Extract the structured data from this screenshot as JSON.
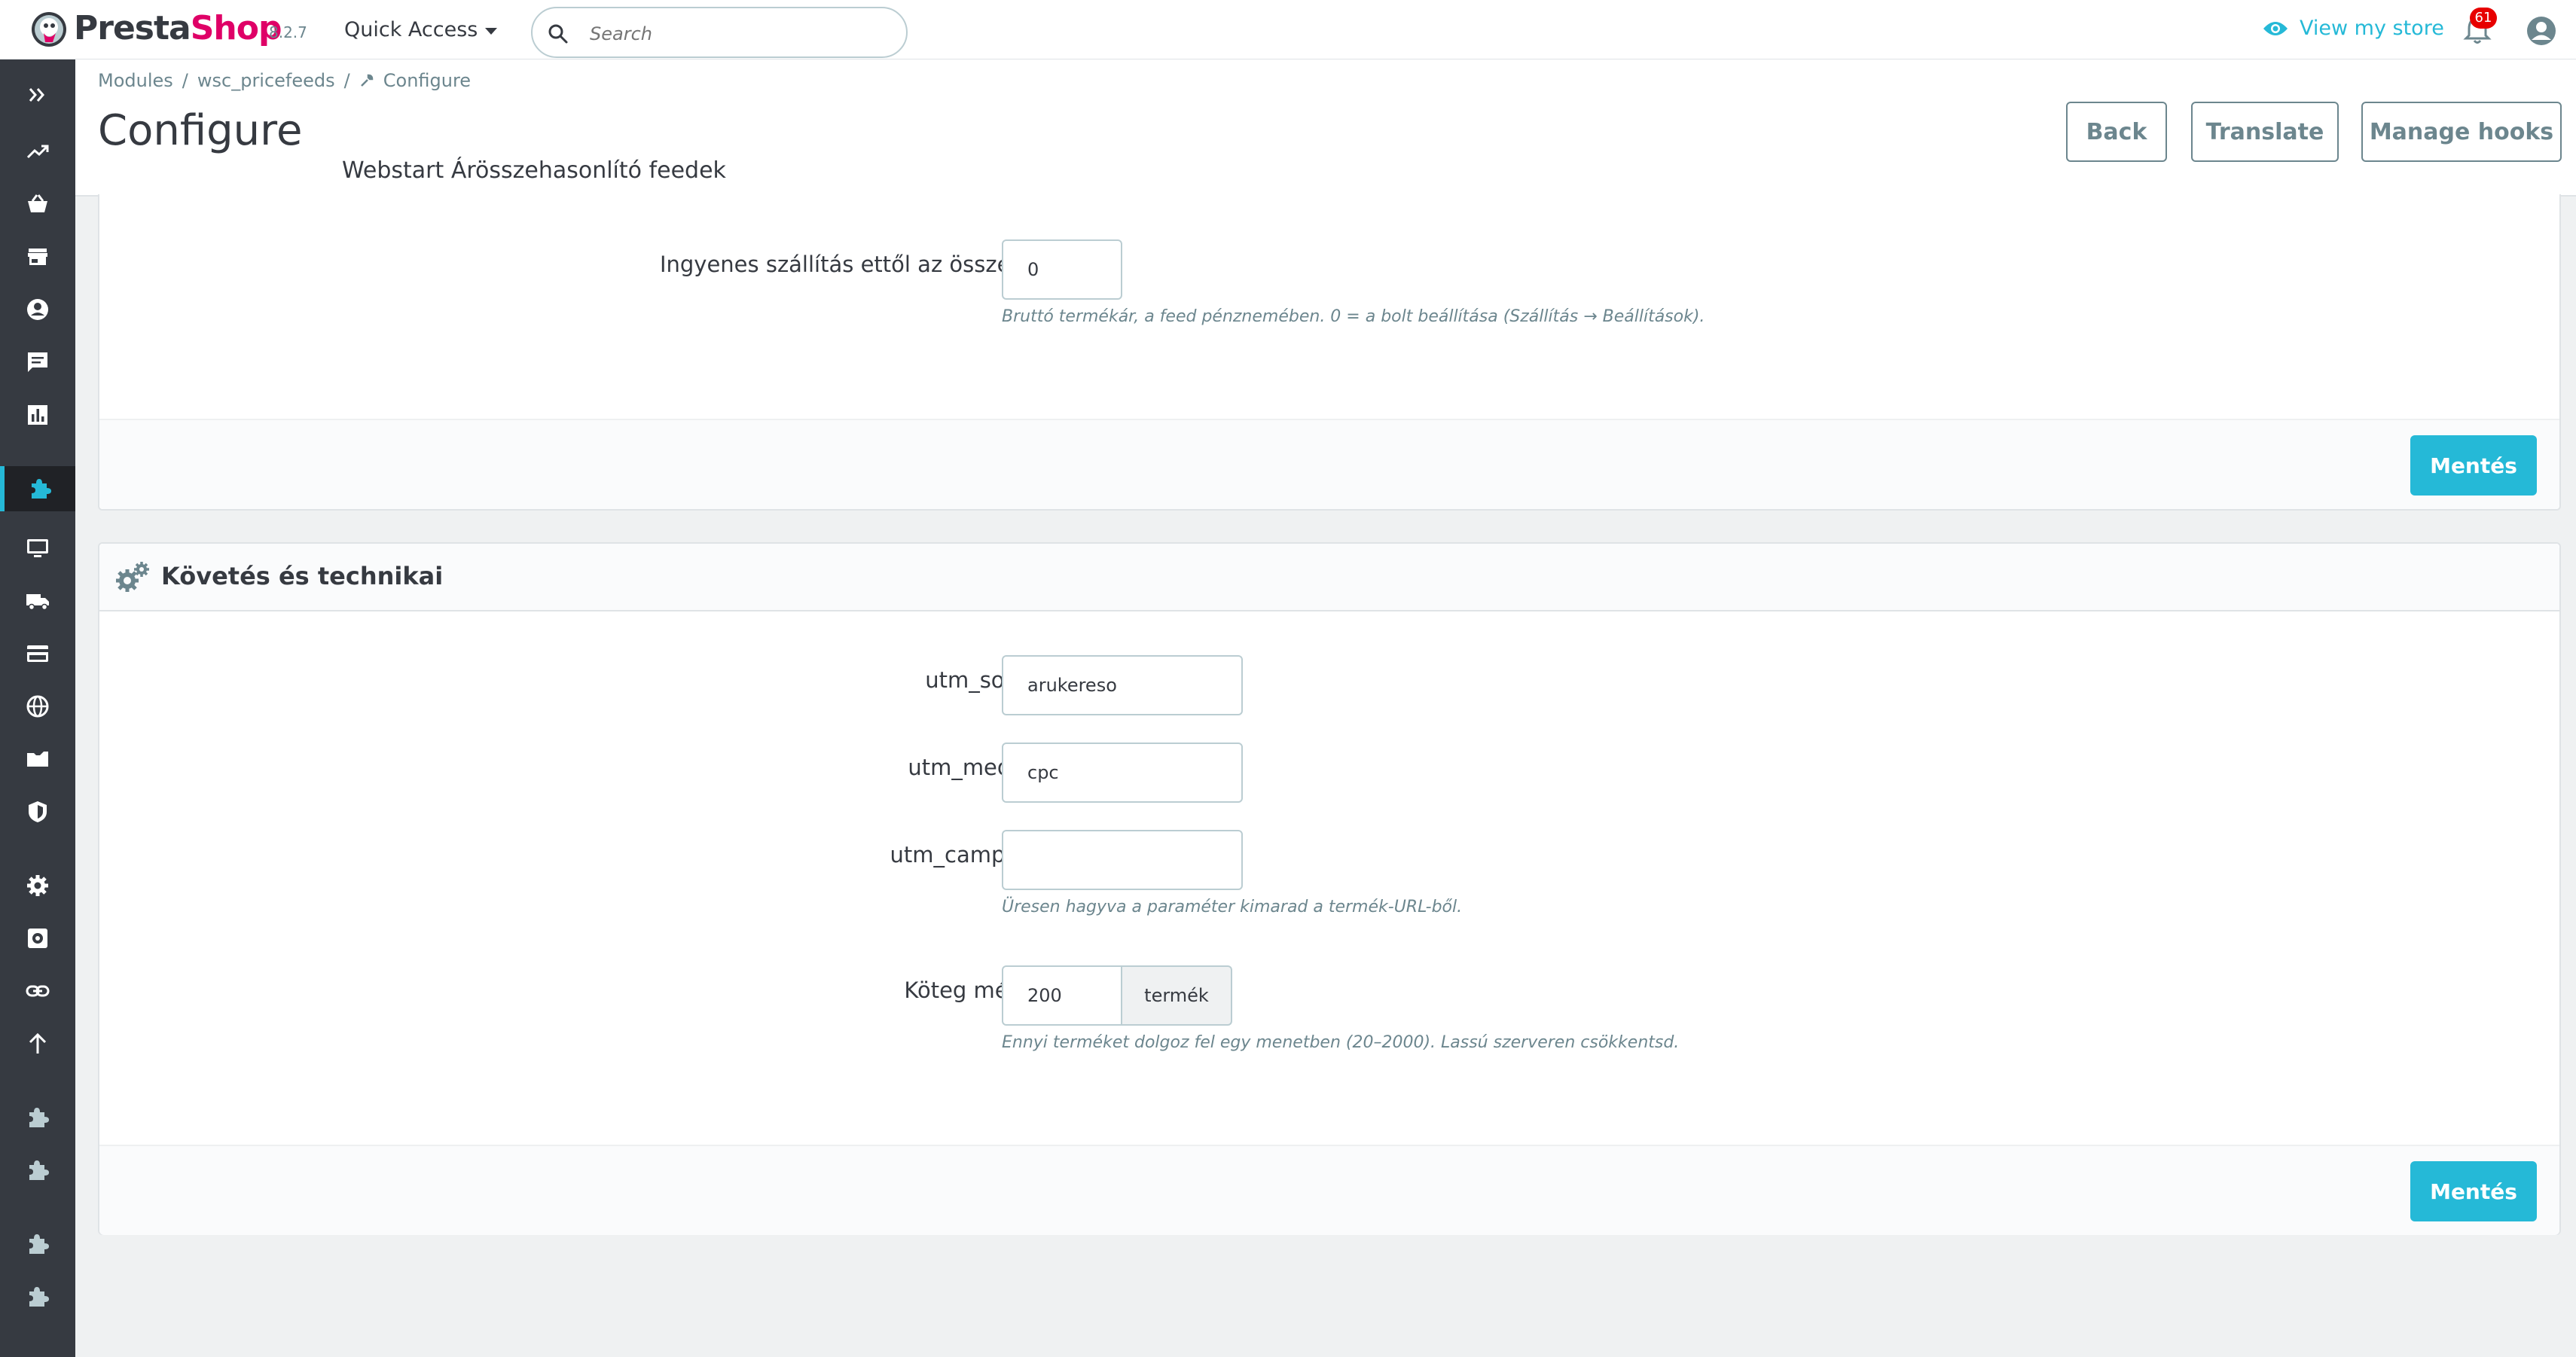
{
  "brand": {
    "name_part1": "Presta",
    "name_part2": "Shop",
    "version": "8.2.7"
  },
  "header": {
    "quick_access": "Quick Access",
    "search_placeholder": "Search",
    "view_store": "View my store",
    "notifications_count": "61"
  },
  "colors": {
    "accent": "#25b9d7",
    "brand_pink": "#df0067",
    "sidebar_bg": "#363a41",
    "badge": "#e70000"
  },
  "sidebar": {
    "items": [
      {
        "icon": "expand-icon"
      },
      {
        "icon": "trending-up-icon"
      },
      {
        "icon": "shopping-basket-icon"
      },
      {
        "icon": "store-icon"
      },
      {
        "icon": "account-circle-icon"
      },
      {
        "icon": "chat-icon"
      },
      {
        "icon": "bar-chart-icon"
      },
      {
        "icon": "puzzle-icon",
        "active": true
      },
      {
        "icon": "desktop-icon"
      },
      {
        "icon": "truck-icon"
      },
      {
        "icon": "credit-card-icon"
      },
      {
        "icon": "globe-icon"
      },
      {
        "icon": "folder-icon"
      },
      {
        "icon": "shield-icon"
      },
      {
        "icon": "gear-icon"
      },
      {
        "icon": "gear-box-icon"
      },
      {
        "icon": "link-icon"
      },
      {
        "icon": "arrow-up-icon"
      },
      {
        "icon": "puzzle-icon"
      },
      {
        "icon": "puzzle-icon"
      },
      {
        "icon": "puzzle-icon"
      },
      {
        "icon": "puzzle-icon"
      }
    ]
  },
  "breadcrumb": {
    "item1": "Modules",
    "item2": "wsc_pricefeeds",
    "item3": "Configure"
  },
  "page": {
    "title": "Configure",
    "subtitle": "Webstart Árösszehasonlító feedek",
    "buttons": {
      "back": "Back",
      "translate": "Translate",
      "manage_hooks": "Manage hooks"
    }
  },
  "panel_shipping": {
    "free_shipping_label": "Ingyenes szállítás ettől az összegtől",
    "free_shipping_value": "0",
    "free_shipping_help": "Bruttó termékár, a feed pénznemében. 0 = a bolt beállítása (Szállítás → Beállítások).",
    "save": "Mentés"
  },
  "panel_tracking": {
    "title": "Követés és technikai",
    "utm_source_label": "utm_source",
    "utm_source_value": "arukereso",
    "utm_medium_label": "utm_medium",
    "utm_medium_value": "cpc",
    "utm_campaign_label": "utm_campaign",
    "utm_campaign_value": "",
    "utm_campaign_help": "Üresen hagyva a paraméter kimarad a termék-URL-ből.",
    "batch_label": "Köteg mérete",
    "batch_value": "200",
    "batch_addon": "termék",
    "batch_help": "Ennyi terméket dolgoz fel egy menetben (20–2000). Lassú szerveren csökkentsd.",
    "save": "Mentés"
  }
}
